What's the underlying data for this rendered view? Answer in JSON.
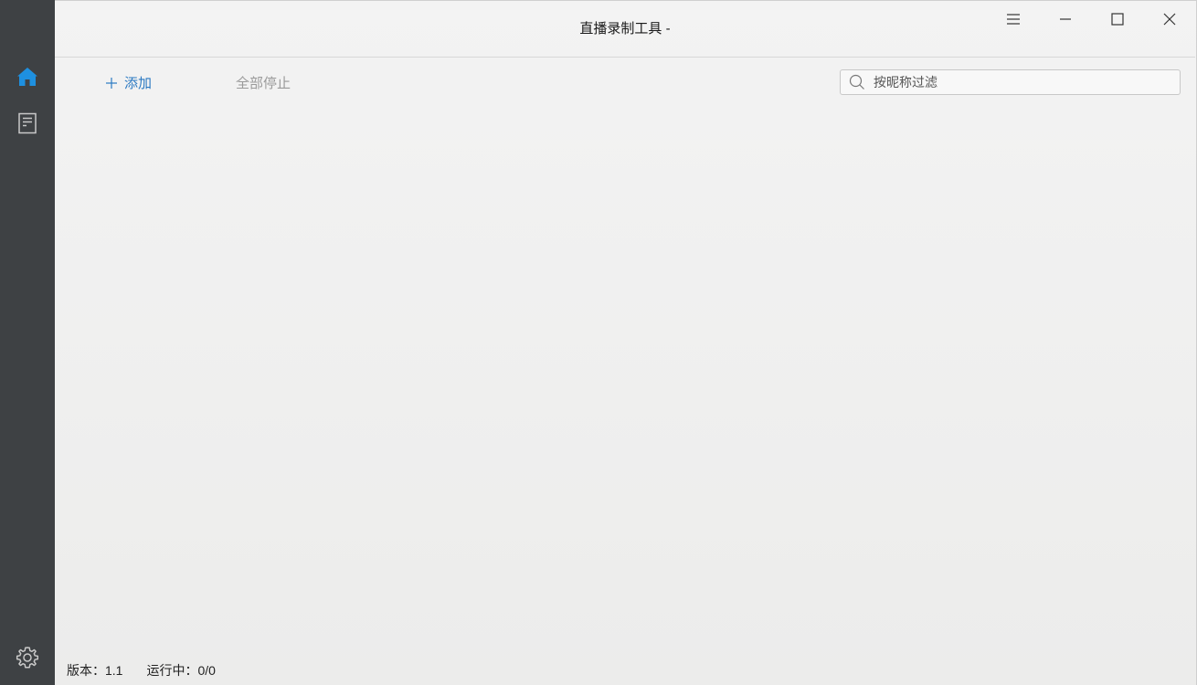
{
  "window": {
    "title": "直播录制工具 - ",
    "menu_icon": "hamburger-menu-icon",
    "min_icon": "minimize-icon",
    "max_icon": "maximize-icon",
    "close_icon": "close-icon"
  },
  "sidebar": {
    "items": [
      {
        "icon": "home-icon",
        "active": true,
        "color": "#1e90e0"
      },
      {
        "icon": "document-icon",
        "active": false,
        "color": "#c9c9c9"
      }
    ],
    "settings_icon": "gear-icon"
  },
  "toolbar": {
    "add_icon": "plus-icon",
    "add_label": "添加",
    "stop_all_label": "全部停止",
    "filter_placeholder": "按昵称过滤",
    "filter_value": ""
  },
  "status": {
    "version_label": "版本：",
    "version_value": "1.1",
    "running_label": "运行中：",
    "running_value": "0/0"
  },
  "colors": {
    "sidebar_bg": "#3e4144",
    "accent": "#2b79c2",
    "disabled_text": "#9a9a9a"
  }
}
